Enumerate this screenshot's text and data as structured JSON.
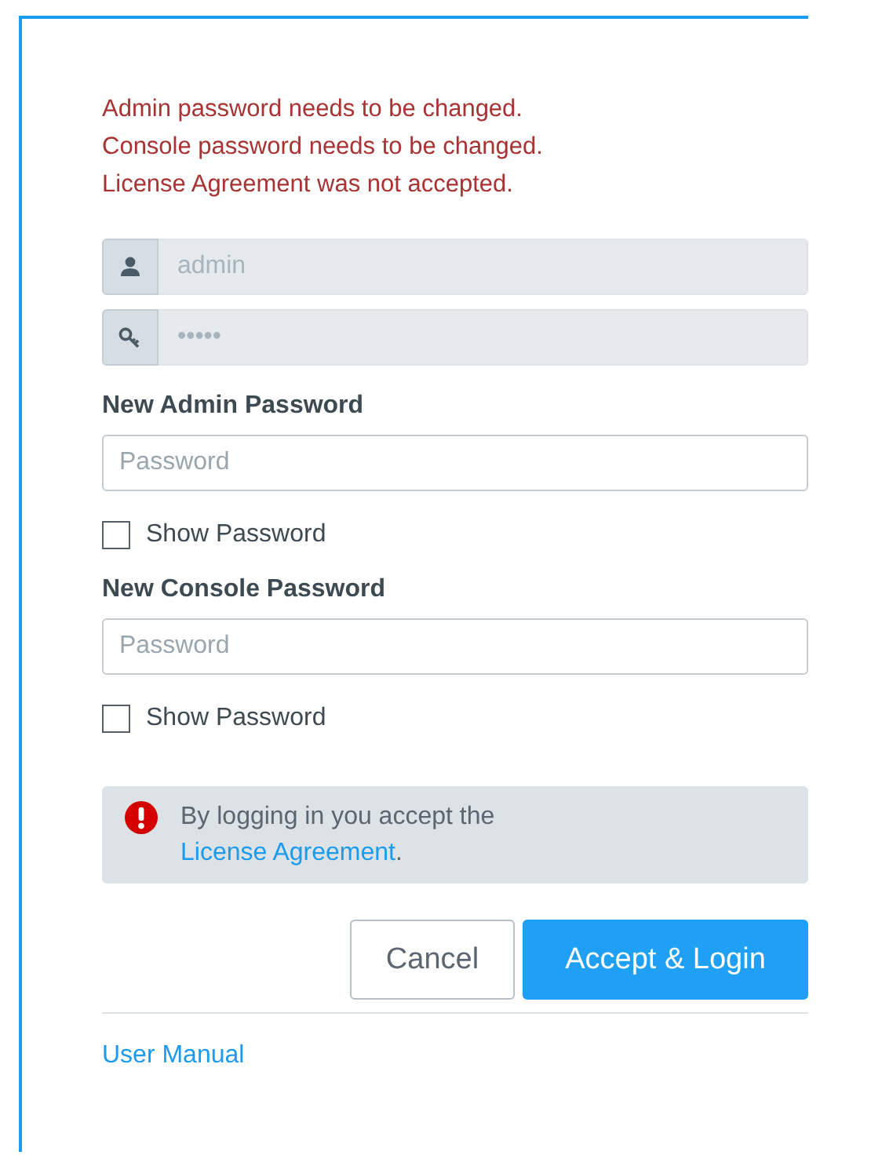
{
  "errors": [
    "Admin password needs to be changed.",
    "Console password needs to be changed.",
    "License Agreement was not accepted."
  ],
  "login_fields": [
    {
      "kind": "user",
      "value": "admin",
      "disabled": true
    },
    {
      "kind": "key",
      "value": "•••••",
      "disabled": true
    }
  ],
  "password_sections": [
    {
      "label": "New Admin Password",
      "placeholder": "Password",
      "show_password": {
        "label": "Show Password",
        "checked": false
      }
    },
    {
      "label": "New Console Password",
      "placeholder": "Password",
      "show_password": {
        "label": "Show Password",
        "checked": false
      }
    }
  ],
  "notice": {
    "text": "By logging in you accept the ",
    "link": "License Agreement",
    "suffix": "."
  },
  "buttons": [
    {
      "kind": "secondary",
      "label": "Cancel"
    },
    {
      "kind": "primary",
      "label": "Accept & Login"
    }
  ],
  "footer_link": "User Manual"
}
